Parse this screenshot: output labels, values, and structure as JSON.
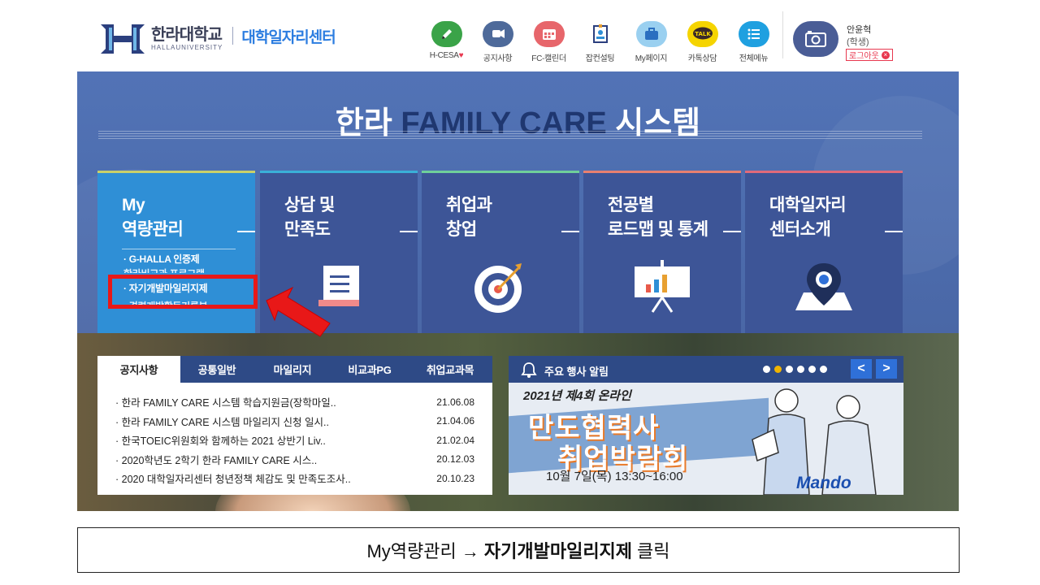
{
  "header": {
    "logo_name": "한라대학교",
    "logo_sub": "HALLAUNIVERSITY",
    "center_name": "대학일자리센터",
    "quick_links": [
      {
        "label": "H-CESA",
        "suffix": "♥",
        "icon": "pencil-icon",
        "color": "#3aa348"
      },
      {
        "label": "공지사항",
        "suffix": "",
        "icon": "megaphone-icon",
        "color": "#4e6a9a"
      },
      {
        "label": "FC-캘린더",
        "suffix": "",
        "icon": "calendar-icon",
        "color": "#e7666b"
      },
      {
        "label": "잡컨설팅",
        "suffix": "",
        "icon": "id-badge-icon",
        "color": "#ffffff"
      },
      {
        "label": "My페이지",
        "suffix": "",
        "icon": "briefcase-icon",
        "color": "#9ad0f0"
      },
      {
        "label": "카톡상담",
        "suffix": "",
        "icon": "kakaotalk-icon",
        "color": "#f5d400"
      },
      {
        "label": "전체메뉴",
        "suffix": "",
        "icon": "menu-list-icon",
        "color": "#1fa0e0"
      }
    ],
    "user": {
      "name": "안윤혁",
      "role": "(학생)",
      "logout_label": "로그아웃"
    }
  },
  "hero": {
    "title_prefix": "한라 ",
    "title_accent": "FAMILY CARE",
    "title_suffix": " 시스템",
    "cards": [
      {
        "title": "My\n역량관리",
        "color": "#2f8fd6",
        "bar": "#c9d06a",
        "icon": ""
      },
      {
        "title": "상담 및\n만족도",
        "color": "#3d5597",
        "bar": "#3ab0d8",
        "icon": "document-icon"
      },
      {
        "title": "취업과\n창업",
        "color": "#3d5597",
        "bar": "#6fcf9a",
        "icon": "target-icon"
      },
      {
        "title": "전공별\n로드맵 및 통계",
        "color": "#3d5597",
        "bar": "#e88070",
        "icon": "chart-board-icon"
      },
      {
        "title": "대학일자리\n센터소개",
        "color": "#3d5597",
        "bar": "#e06a7a",
        "icon": "location-pin-icon"
      }
    ],
    "my_submenu": [
      "· G-HALLA 인증제",
      "한라비교과 프로그램",
      "· 자기개발마일리지제",
      "· 경력개발활동기록부"
    ]
  },
  "notice": {
    "tabs": [
      "공지사항",
      "공통일반",
      "마일리지",
      "비교과PG",
      "취업교과목"
    ],
    "active_tab": 0,
    "rows": [
      {
        "title": "· 한라 FAMILY CARE 시스템 학습지원금(장학마일..",
        "date": "21.06.08"
      },
      {
        "title": "· 한라 FAMILY CARE 시스템 마일리지 신청 일시..",
        "date": "21.04.06"
      },
      {
        "title": "· 한국TOEIC위원회와 함께하는 2021 상반기 Liv..",
        "date": "21.02.04"
      },
      {
        "title": "· 2020학년도 2학기 한라 FAMILY CARE 시스..",
        "date": "20.12.03"
      },
      {
        "title": "· 2020 대학일자리센터 청년정책 체감도 및 만족도조사..",
        "date": "20.10.23"
      }
    ]
  },
  "events": {
    "title": "주요 행사 알림",
    "dots_total": 6,
    "dots_active": 1,
    "prev_label": "<",
    "next_label": ">",
    "banner": {
      "edition": "2021년 제4회 온라인",
      "line1": "만도협력사",
      "line2": "취업박람회",
      "date": "10월 7일(목) 13:30~16:00",
      "brand": "Mando"
    }
  },
  "caption": {
    "prefix": "My역량관리 →",
    "bold": "자기개발마일리지제",
    "suffix": "클릭"
  }
}
